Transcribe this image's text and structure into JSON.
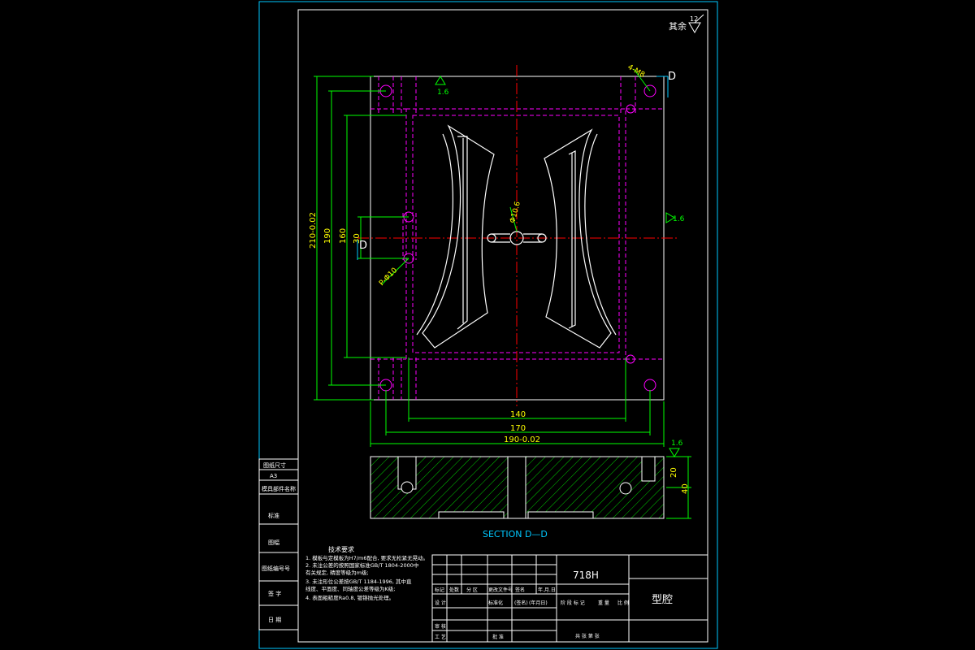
{
  "drawing": {
    "roughness_note": {
      "label": "其余",
      "value": "12"
    },
    "section_label": "SECTION  D—D",
    "section_marks": {
      "top": "D",
      "left": "D"
    },
    "roughness_marks": [
      "1.6",
      "1.6",
      "1.6"
    ],
    "dimensions": {
      "total_height": "210-0.02",
      "height_190": "190",
      "height_160": "160",
      "offset_30": "30",
      "width_140": "140",
      "width_170": "170",
      "total_width": "190-0.02",
      "section_20": "20",
      "section_40": "40",
      "hole_top_right": "4-M8",
      "hole_left": "P-Φ10",
      "gate_note": "Φ10.6"
    }
  },
  "side_table": {
    "rows": [
      "图纸尺寸",
      "A3",
      "模具部件名称",
      "标准",
      "图幅",
      "图纸编号号",
      "签  字",
      "日  期"
    ]
  },
  "tech_requirements": {
    "title": "技术要求",
    "lines": [
      "1. 模板与定模板为H7/m6配合, 要求无松紧无晃动。",
      "2. 未注公差的按照国家标准GB/T 1804-2000中",
      "   有关规定, 精度等级为m级;",
      "3. 未注形位公差按GB/T 1184-1996, 其中直",
      "   线度、平面度、同轴度公差等级为K级;",
      "4. 表面粗糙度Ra0.8, 镀铬抛光处理。"
    ]
  },
  "title_block": {
    "material": "718H",
    "part_name": "型腔",
    "header_cells": [
      "标记",
      "处数",
      "分 区",
      "更改文件号",
      "签名",
      "年.月.日"
    ],
    "row_design": [
      "设 计",
      "(签名)",
      "(年月日)",
      "标准化",
      "(签名)",
      "(年月日)"
    ],
    "row_review": "审 核",
    "row_process": "工 艺",
    "row_approve": "批 准",
    "stage_labels": [
      "阶 段 标 记",
      "重 量",
      "比 例"
    ],
    "sheet_labels": [
      "共  张  第  张"
    ]
  }
}
